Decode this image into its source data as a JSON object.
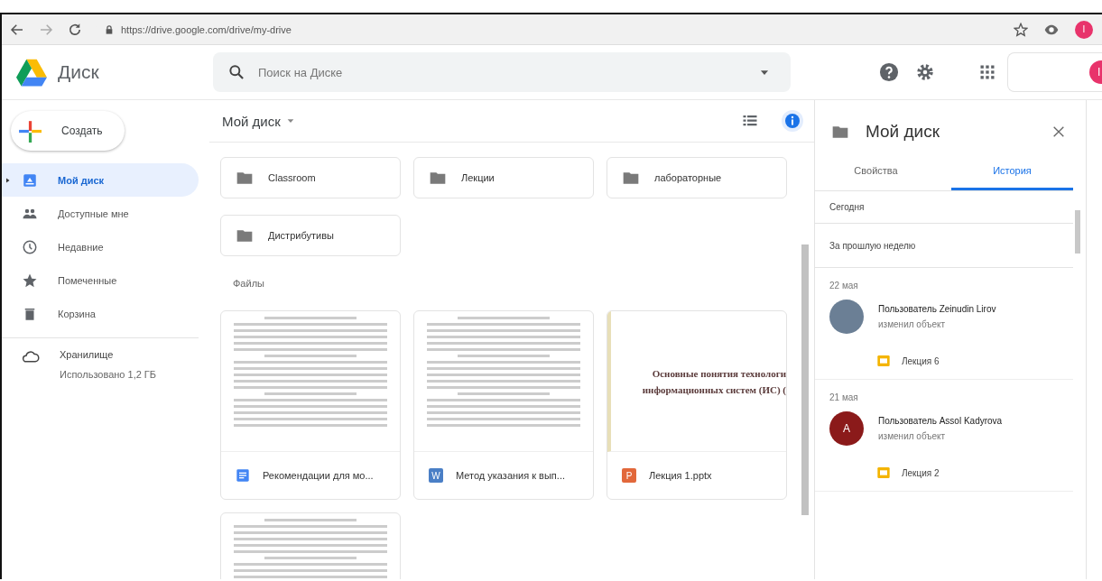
{
  "browser": {
    "url": "https://drive.google.com/drive/my-drive",
    "profile_letter": "I"
  },
  "header": {
    "logo_text": "Диск",
    "search": {
      "placeholder": "Поиск на Диске"
    },
    "account_letter": "I"
  },
  "sidebar": {
    "create_label": "Создать",
    "items": [
      {
        "label": "Мой диск",
        "selected": true
      },
      {
        "label": "Доступные мне",
        "selected": false
      },
      {
        "label": "Недавние",
        "selected": false
      },
      {
        "label": "Помеченные",
        "selected": false
      },
      {
        "label": "Корзина",
        "selected": false
      }
    ],
    "storage": {
      "label": "Хранилище",
      "usage": "Использовано 1,2 ГБ"
    }
  },
  "main": {
    "breadcrumb": "Мой диск",
    "folders": [
      "Classroom",
      "Лекции",
      "лабораторные",
      "Дистрибутивы"
    ],
    "files_heading": "Файлы",
    "files": [
      {
        "kind": "doc",
        "name": "Рекомендации для мо..."
      },
      {
        "kind": "word",
        "icon_letter": "W",
        "name": "Метод указания к вып..."
      },
      {
        "kind": "ppt",
        "icon_letter": "P",
        "name": "Лекция 1.pptx",
        "slide_lines": [
          "Основные понятия технологи",
          "информационных систем (ИС) ("
        ]
      },
      {
        "kind": "doc"
      }
    ]
  },
  "details": {
    "title": "Мой диск",
    "tabs": [
      {
        "label": "Свойства",
        "selected": false
      },
      {
        "label": "История",
        "selected": true
      }
    ],
    "periods": [
      "Сегодня",
      "За прошлую неделю"
    ],
    "events": [
      {
        "date": "22 мая",
        "avatar": {
          "kind": "photo"
        },
        "user": "Пользователь Zeinudin Lirov",
        "action": "изменил объект",
        "item": "Лекция 6"
      },
      {
        "date": "21 мая",
        "avatar": {
          "kind": "letter",
          "letter": "A",
          "color": "#8b1a1a"
        },
        "user": "Пользователь Assol Kadyrova",
        "action": "изменил объект",
        "item": "Лекция 2"
      }
    ]
  }
}
